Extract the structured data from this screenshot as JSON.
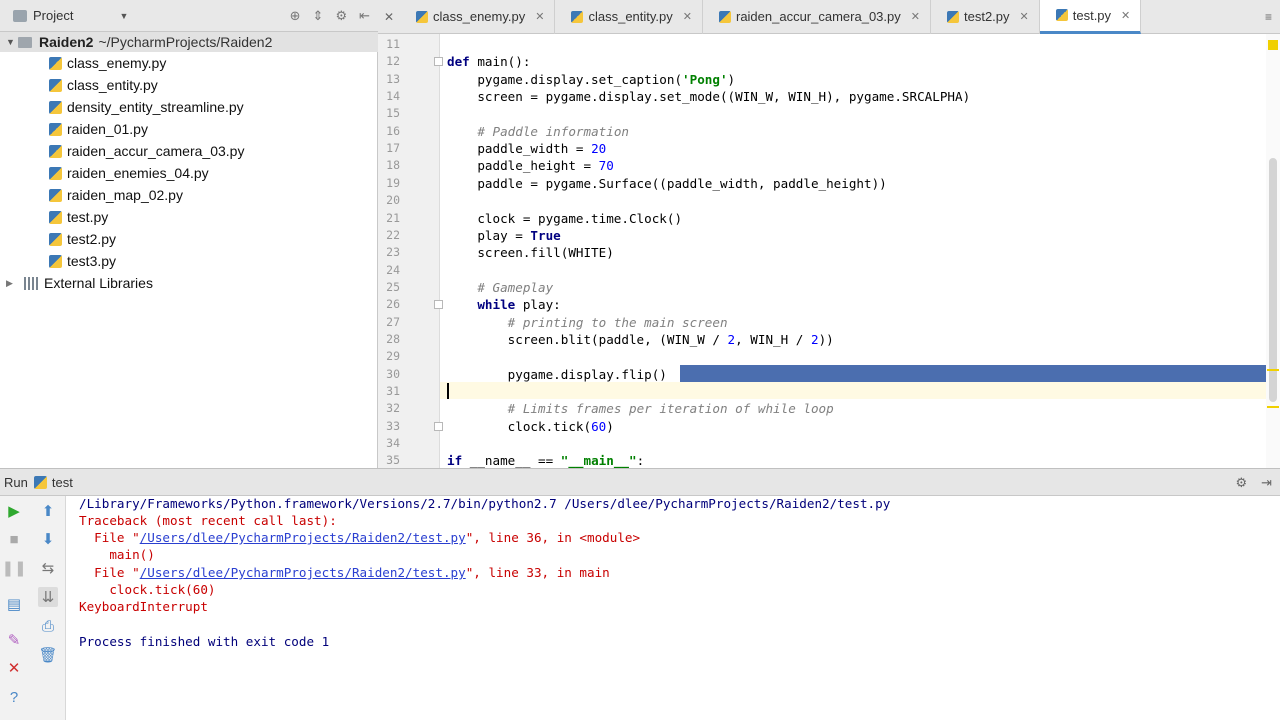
{
  "project": {
    "title": "Project",
    "root_name": "Raiden2",
    "root_path": "~/PycharmProjects/Raiden2",
    "files": [
      "class_enemy.py",
      "class_entity.py",
      "density_entity_streamline.py",
      "raiden_01.py",
      "raiden_accur_camera_03.py",
      "raiden_enemies_04.py",
      "raiden_map_02.py",
      "test.py",
      "test2.py",
      "test3.py"
    ],
    "external_libraries": "External Libraries"
  },
  "tabs": [
    {
      "label": "class_enemy.py",
      "active": false
    },
    {
      "label": "class_entity.py",
      "active": false
    },
    {
      "label": "raiden_accur_camera_03.py",
      "active": false
    },
    {
      "label": "test2.py",
      "active": false
    },
    {
      "label": "test.py",
      "active": true
    }
  ],
  "editor": {
    "line_numbers": [
      "11",
      "12",
      "13",
      "14",
      "15",
      "16",
      "17",
      "18",
      "19",
      "20",
      "21",
      "22",
      "23",
      "24",
      "25",
      "26",
      "27",
      "28",
      "29",
      "30",
      "31",
      "32",
      "33",
      "34",
      "35"
    ],
    "lines": [
      "",
      "def main():",
      "    pygame.display.set_caption('Pong')",
      "    screen = pygame.display.set_mode((WIN_W, WIN_H), pygame.SRCALPHA)",
      "",
      "    # Paddle information",
      "    paddle_width = 20",
      "    paddle_height = 70",
      "    paddle = pygame.Surface((paddle_width, paddle_height))",
      "",
      "    clock = pygame.time.Clock()",
      "    play = True",
      "    screen.fill(WHITE)",
      "",
      "    # Gameplay",
      "    while play:",
      "        # printing to the main screen",
      "        screen.blit(paddle, (WIN_W / 2, WIN_H / 2))",
      "",
      "        pygame.display.flip()",
      "",
      "        # Limits frames per iteration of while loop",
      "        clock.tick(60)",
      "",
      "if __name__ == \"__main__\":"
    ]
  },
  "run": {
    "label": "Run",
    "config_name": "test",
    "output": {
      "cmd": "/Library/Frameworks/Python.framework/Versions/2.7/bin/python2.7 /Users/dlee/PycharmProjects/Raiden2/test.py",
      "traceback_header": "Traceback (most recent call last):",
      "file_prefix": "  File \"",
      "file_link": "/Users/dlee/PycharmProjects/Raiden2/test.py",
      "frame1_suffix": "\", line 36, in <module>",
      "frame1_code": "    main()",
      "frame2_suffix": "\", line 33, in main",
      "frame2_code": "    clock.tick(60)",
      "error": "KeyboardInterrupt",
      "exit": "Process finished with exit code 1"
    }
  },
  "colors": {
    "selection": "#4b6eaf",
    "keyword": "#000080",
    "string": "#008000",
    "number": "#0000ff",
    "comment": "#808080",
    "error_text": "#c80000",
    "link": "#2a3fd0"
  }
}
